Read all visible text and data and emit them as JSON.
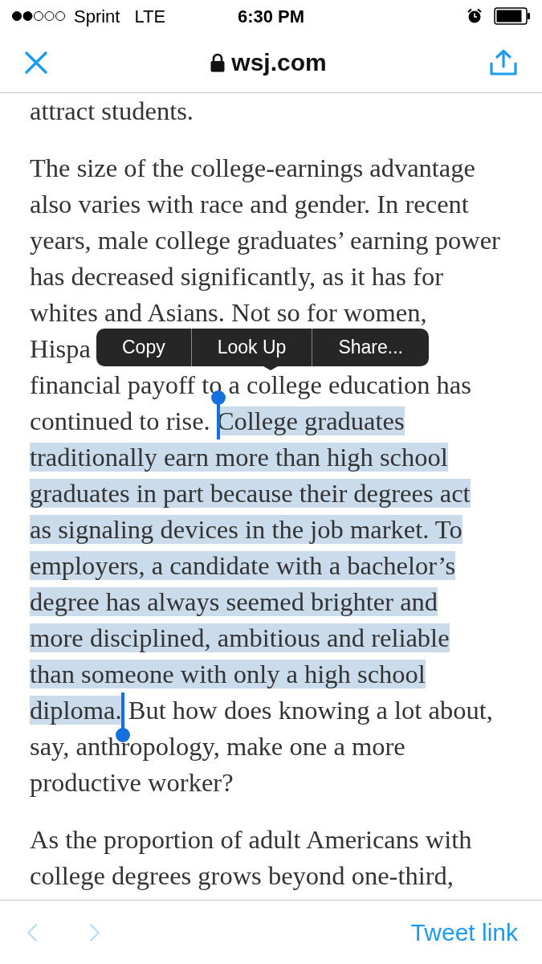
{
  "status_bar": {
    "carrier": "Sprint",
    "network": "LTE",
    "time": "6:30 PM"
  },
  "nav_bar": {
    "domain": "wsj.com"
  },
  "article": {
    "paragraphs": [
      {
        "lines": [
          {
            "segments": [
              {
                "text": "attract students.",
                "selected": false
              }
            ]
          }
        ]
      },
      {
        "lines": [
          {
            "segments": [
              {
                "text": "The size of the college-earnings advantage",
                "selected": false
              }
            ]
          },
          {
            "segments": [
              {
                "text": "also varies with race and gender. In recent",
                "selected": false
              }
            ]
          },
          {
            "segments": [
              {
                "text": "years, male college graduates’ earning power",
                "selected": false
              }
            ]
          },
          {
            "segments": [
              {
                "text": "has decreased significantly, as it has for",
                "selected": false
              }
            ]
          },
          {
            "segments": [
              {
                "text": "whites and Asians. Not so for women,",
                "selected": false
              }
            ]
          },
          {
            "segments": [
              {
                "text": "Hispa",
                "selected": false
              }
            ]
          },
          {
            "segments": [
              {
                "text": "financial payoff to a college education has",
                "selected": false
              }
            ]
          },
          {
            "segments": [
              {
                "text": "continued to rise.",
                "selected": false
              },
              {
                "text": "College graduates",
                "selected": true
              }
            ]
          },
          {
            "segments": [
              {
                "text": "traditionally earn more than high school",
                "selected": true
              }
            ]
          },
          {
            "segments": [
              {
                "text": "graduates in part because their degrees act",
                "selected": true
              }
            ]
          },
          {
            "segments": [
              {
                "text": "as signaling devices in the job market. To",
                "selected": true
              }
            ]
          },
          {
            "segments": [
              {
                "text": "employers, a candidate with a bachelor’s",
                "selected": true
              }
            ]
          },
          {
            "segments": [
              {
                "text": "degree has always seemed brighter and",
                "selected": true
              }
            ]
          },
          {
            "segments": [
              {
                "text": "more disciplined, ambitious and reliable",
                "selected": true
              }
            ]
          },
          {
            "segments": [
              {
                "text": "than someone with only a high school",
                "selected": true
              }
            ]
          },
          {
            "segments": [
              {
                "text": "diploma.",
                "selected": true
              },
              {
                "text": "But how does knowing a lot about,",
                "selected": false
              }
            ]
          },
          {
            "segments": [
              {
                "text": "say, anthropology, make one a more",
                "selected": false
              }
            ]
          },
          {
            "segments": [
              {
                "text": "productive worker?",
                "selected": false
              }
            ]
          }
        ]
      },
      {
        "lines": [
          {
            "segments": [
              {
                "text": "As the proportion of adult Americans with",
                "selected": false
              }
            ]
          },
          {
            "segments": [
              {
                "text": "college degrees grows beyond one-third,",
                "selected": false
              }
            ]
          }
        ]
      }
    ]
  },
  "edit_menu": [
    "Copy",
    "Look Up",
    "Share..."
  ],
  "toolbar": {
    "back": {
      "disabled": true
    },
    "forward": {
      "disabled": true
    },
    "action": "Tweet link"
  }
}
